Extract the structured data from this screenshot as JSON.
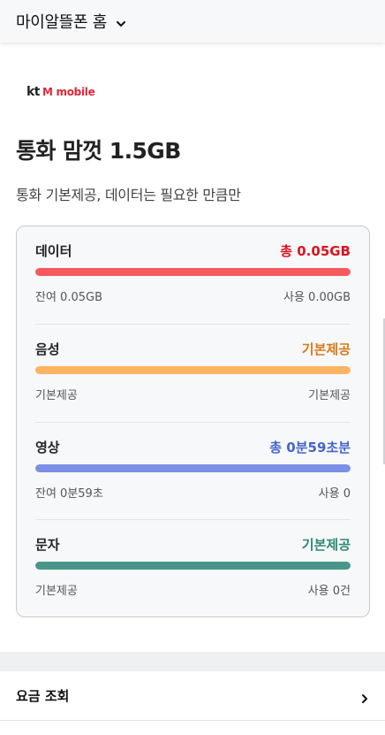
{
  "header": {
    "title": "마이알뜰폰 홈"
  },
  "brand": {
    "kt": "kt",
    "mobile": "M mobile"
  },
  "plan": {
    "name": "통화 맘껏 1.5GB",
    "description": "통화 기본제공, 데이터는 필요한 만큼만"
  },
  "usage": {
    "data": {
      "label": "데이터",
      "value": "총 0.05GB",
      "left": "잔여 0.05GB",
      "right": "사용 0.00GB",
      "fill_pct": 100,
      "color": "#f65a5f",
      "value_color": "#d8151f"
    },
    "voice": {
      "label": "음성",
      "value": "기본제공",
      "left": "기본제공",
      "right": "기본제공",
      "fill_pct": 100,
      "color": "#ffb463",
      "value_color": "#d9791b"
    },
    "video": {
      "label": "영상",
      "value": "총 0분59초분",
      "left": "잔여 0분59초",
      "right": "사용 0",
      "fill_pct": 100,
      "color": "#7b90e6",
      "value_color": "#4465c7"
    },
    "sms": {
      "label": "문자",
      "value": "기본제공",
      "left": "기본제공",
      "right": "사용 0건",
      "fill_pct": 100,
      "color": "#4a958a",
      "value_color": "#2e8a76"
    }
  },
  "menu": {
    "bill_inquiry": "요금 조회"
  },
  "icons": {
    "header_dropdown": "chevron-down-icon",
    "menu_arrow": "chevron-right-icon"
  }
}
